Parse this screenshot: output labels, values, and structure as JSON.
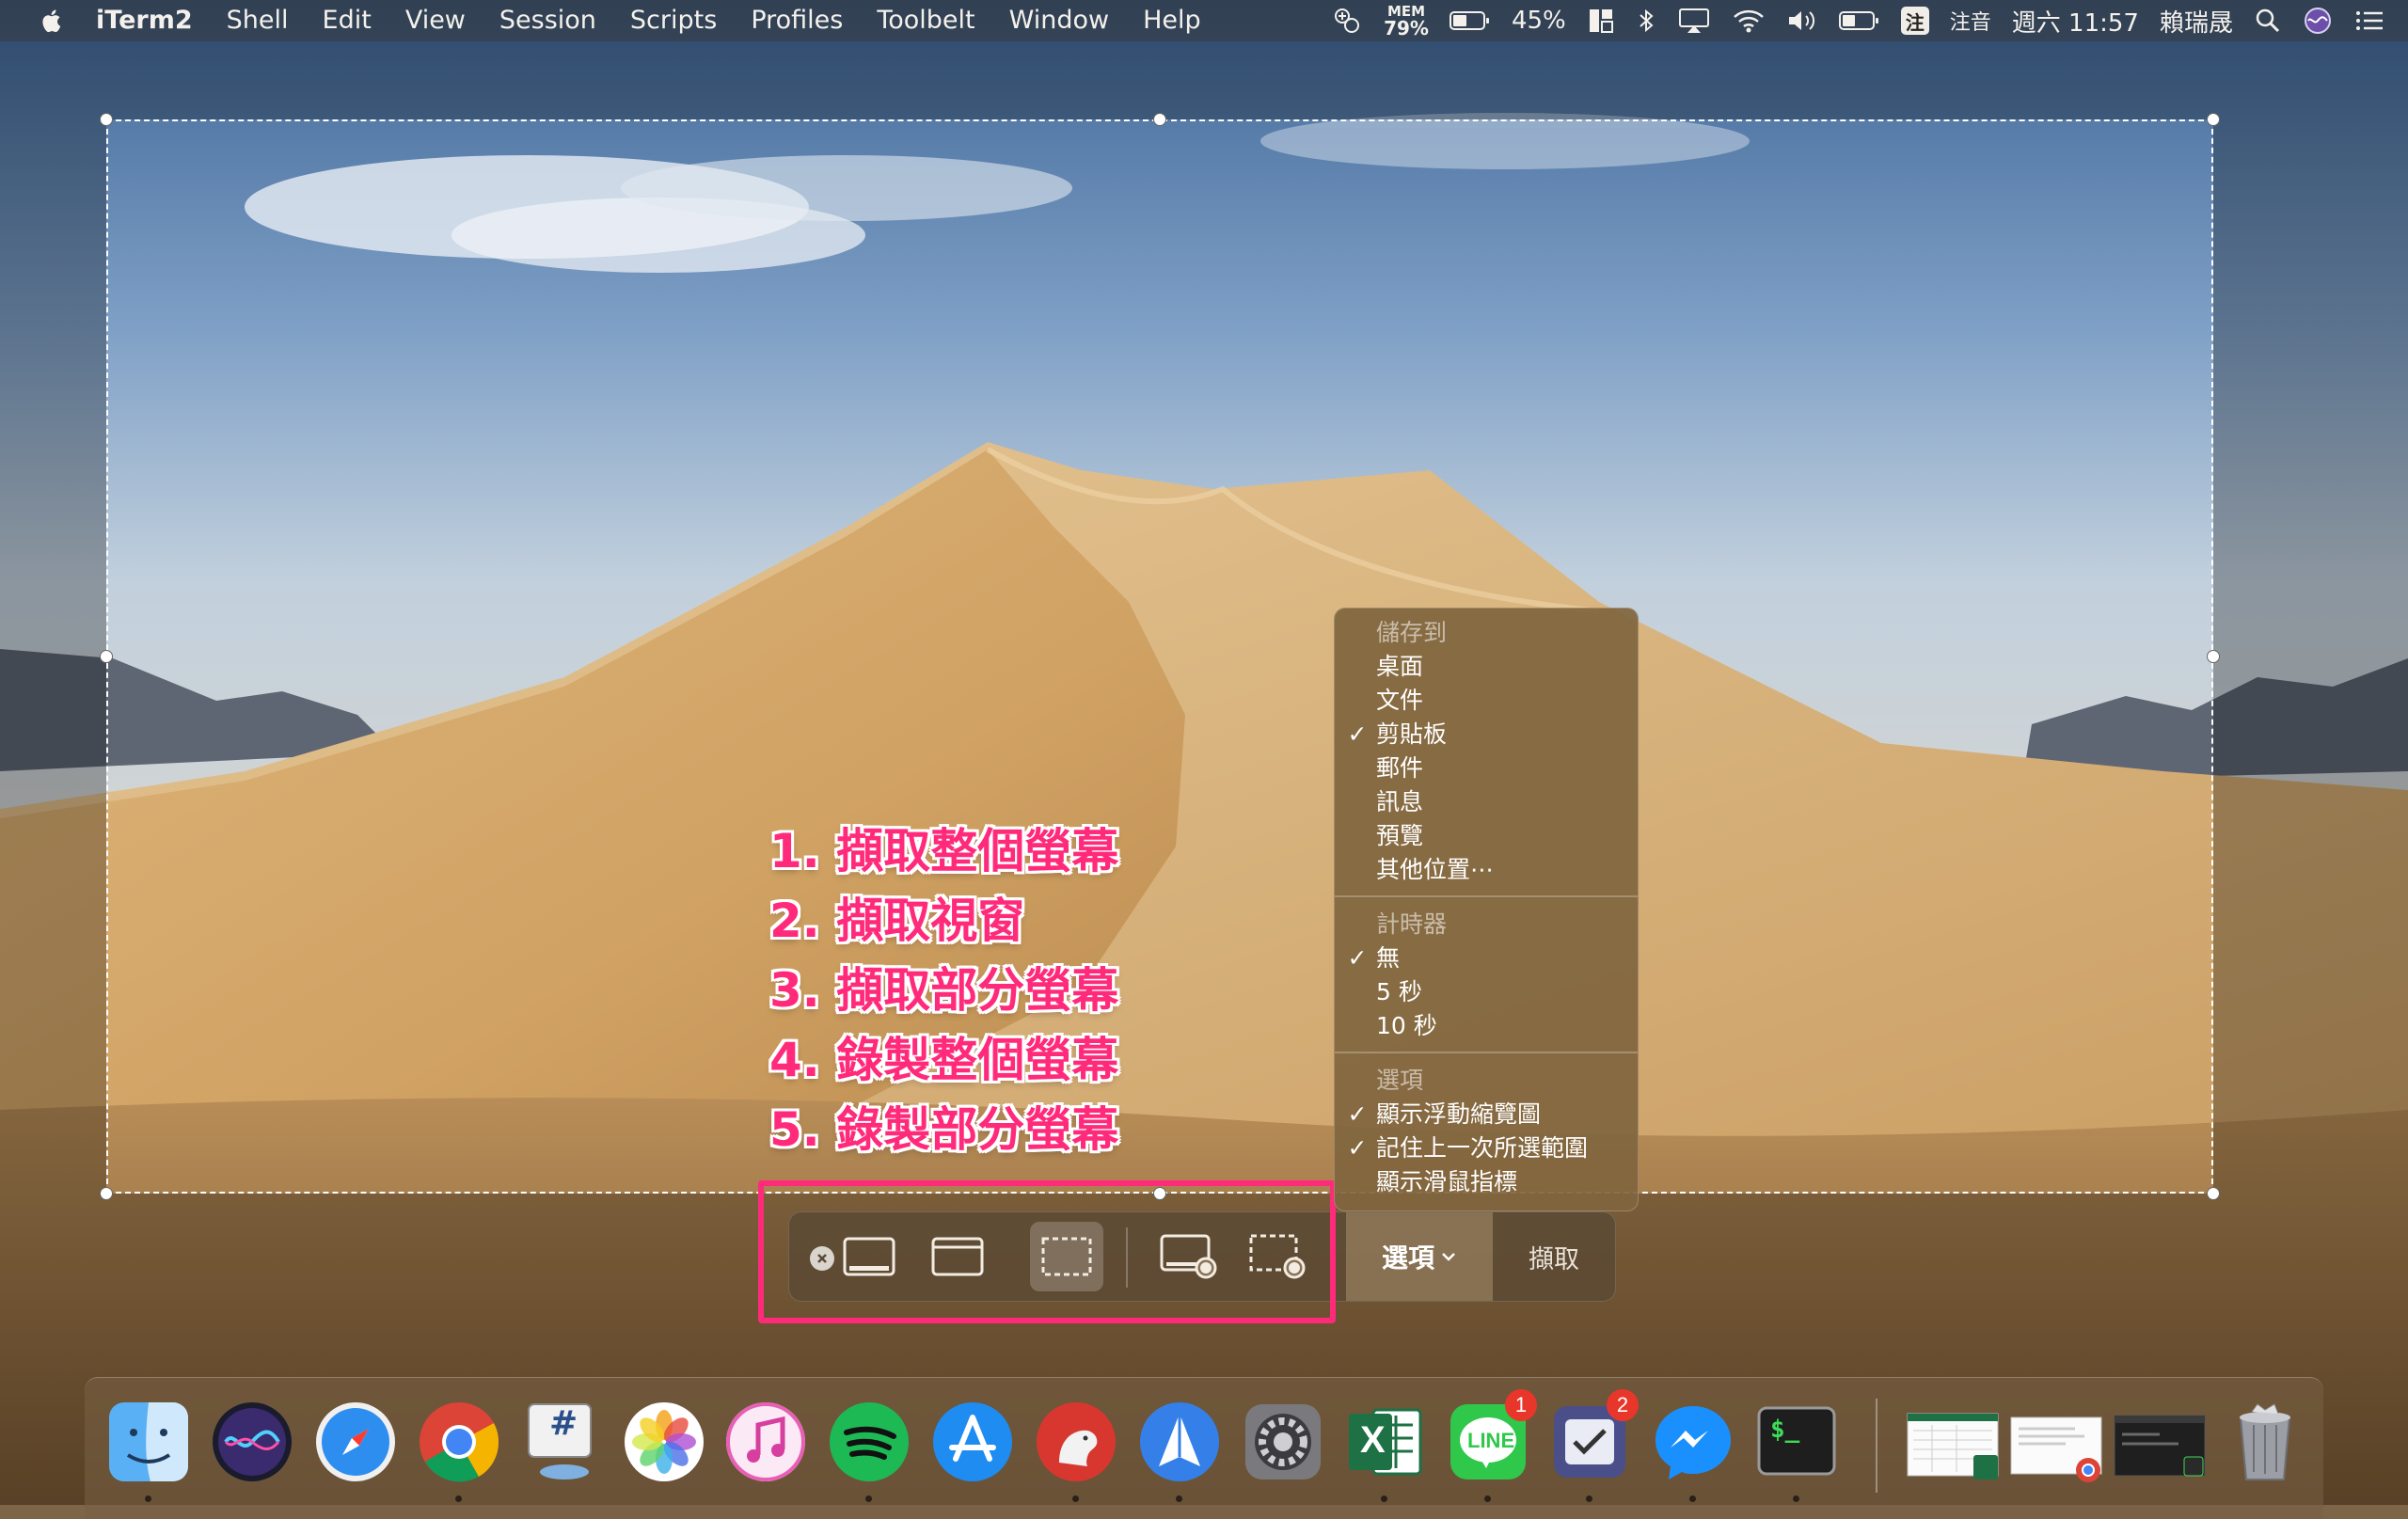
{
  "menubar": {
    "app_name": "iTerm2",
    "items": [
      "Shell",
      "Edit",
      "View",
      "Session",
      "Scripts",
      "Profiles",
      "Toolbelt",
      "Window",
      "Help"
    ],
    "status": {
      "mem_label": "MEM",
      "mem_value": "79%",
      "battery": "45%",
      "ime_badge": "注",
      "ime_name": "注音",
      "clock": "週六 11:57",
      "user": "賴瑞晟"
    }
  },
  "annotations": [
    "1. 擷取整個螢幕",
    "2. 擷取視窗",
    "3. 擷取部分螢幕",
    "4. 錄製整個螢幕",
    "5. 錄製部分螢幕"
  ],
  "toolbar": {
    "options_label": "選項",
    "capture_label": "擷取"
  },
  "options_menu": {
    "save_to": {
      "header": "儲存到",
      "items": [
        {
          "label": "桌面",
          "checked": false
        },
        {
          "label": "文件",
          "checked": false
        },
        {
          "label": "剪貼板",
          "checked": true
        },
        {
          "label": "郵件",
          "checked": false
        },
        {
          "label": "訊息",
          "checked": false
        },
        {
          "label": "預覽",
          "checked": false
        },
        {
          "label": "其他位置⋯",
          "checked": false
        }
      ]
    },
    "timer": {
      "header": "計時器",
      "items": [
        {
          "label": "無",
          "checked": true
        },
        {
          "label": "5 秒",
          "checked": false
        },
        {
          "label": "10 秒",
          "checked": false
        }
      ]
    },
    "options": {
      "header": "選項",
      "items": [
        {
          "label": "顯示浮動縮覽圖",
          "checked": true
        },
        {
          "label": "記住上一次所選範圍",
          "checked": true
        },
        {
          "label": "顯示滑鼠指標",
          "checked": false
        }
      ]
    },
    "check_glyph": "✓"
  },
  "dock": {
    "badges": {
      "line": "1",
      "omnifocus": "2"
    },
    "excel_letter": "X",
    "line_label": "LINE",
    "terminal_prompt": "$_",
    "slack_hash": "#"
  }
}
